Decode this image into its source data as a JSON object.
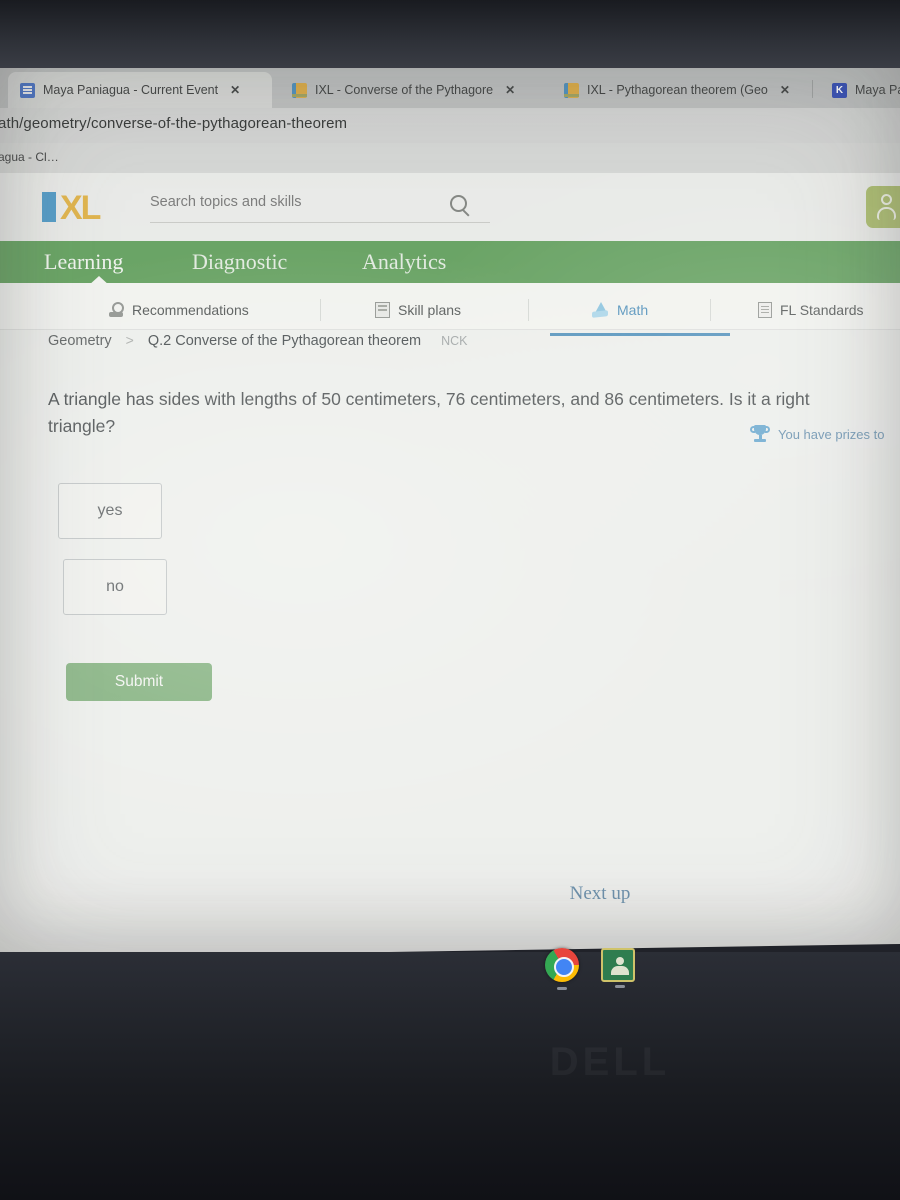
{
  "browser": {
    "tabs": [
      {
        "title": "Maya Paniagua - Current Event",
        "favicon": "docs-icon",
        "close": "✕",
        "active": true
      },
      {
        "title": "IXL - Converse of the Pythagore",
        "favicon": "ixl-icon",
        "close": "✕",
        "active": false
      },
      {
        "title": "IXL - Pythagorean theorem (Geo",
        "favicon": "ixl-icon",
        "close": "✕",
        "active": false
      },
      {
        "title": "Maya Pa",
        "favicon": "kami-icon",
        "close": "",
        "active": false
      }
    ],
    "url": "ath/geometry/converse-of-the-pythagorean-theorem",
    "bookmark": "agua - Cl…"
  },
  "header": {
    "logo_i": "I",
    "logo_xl": "XL",
    "search_placeholder": "Search topics and skills",
    "search_value": "",
    "search_icon": "search-icon",
    "avatar_icon": "user-avatar-icon"
  },
  "green_nav": {
    "items": [
      {
        "label": "Learning",
        "active": true
      },
      {
        "label": "Diagnostic",
        "active": false
      },
      {
        "label": "Analytics",
        "active": false
      }
    ]
  },
  "sub_nav": {
    "items": [
      {
        "label": "Recommendations",
        "icon": "recommendations-icon",
        "active": false
      },
      {
        "label": "Skill plans",
        "icon": "skill-plans-icon",
        "active": false
      },
      {
        "label": "Math",
        "icon": "math-pyramid-icon",
        "active": true
      },
      {
        "label": "FL Standards",
        "icon": "standards-icon",
        "active": false
      }
    ]
  },
  "breadcrumb": {
    "subject": "Geometry",
    "separator": ">",
    "skill": "Q.2 Converse of the Pythagorean theorem",
    "code": "NCK"
  },
  "prizes": {
    "icon": "trophy-icon",
    "text": "You have prizes to"
  },
  "question": {
    "text": "A triangle has sides with lengths of 50 centimeters, 76 centimeters, and 86 centimeters. Is it a right triangle?",
    "options": [
      {
        "label": "yes"
      },
      {
        "label": "no"
      }
    ],
    "submit_label": "Submit"
  },
  "footer": {
    "next_up": "Next up"
  },
  "desktop": {
    "shelf_icons": [
      {
        "name": "chrome-icon"
      },
      {
        "name": "google-classroom-icon"
      }
    ],
    "brand": "DELL"
  },
  "colors": {
    "ixl_green": "#56a250",
    "ixl_blue": "#3e8fc4",
    "ixl_logo_blue": "#3f9bd1",
    "ixl_logo_yellow": "#e8b02c",
    "submit_green": "#70ad6a",
    "avatar_green": "#a7bd59",
    "prize_blue": "#5c8fb5"
  }
}
